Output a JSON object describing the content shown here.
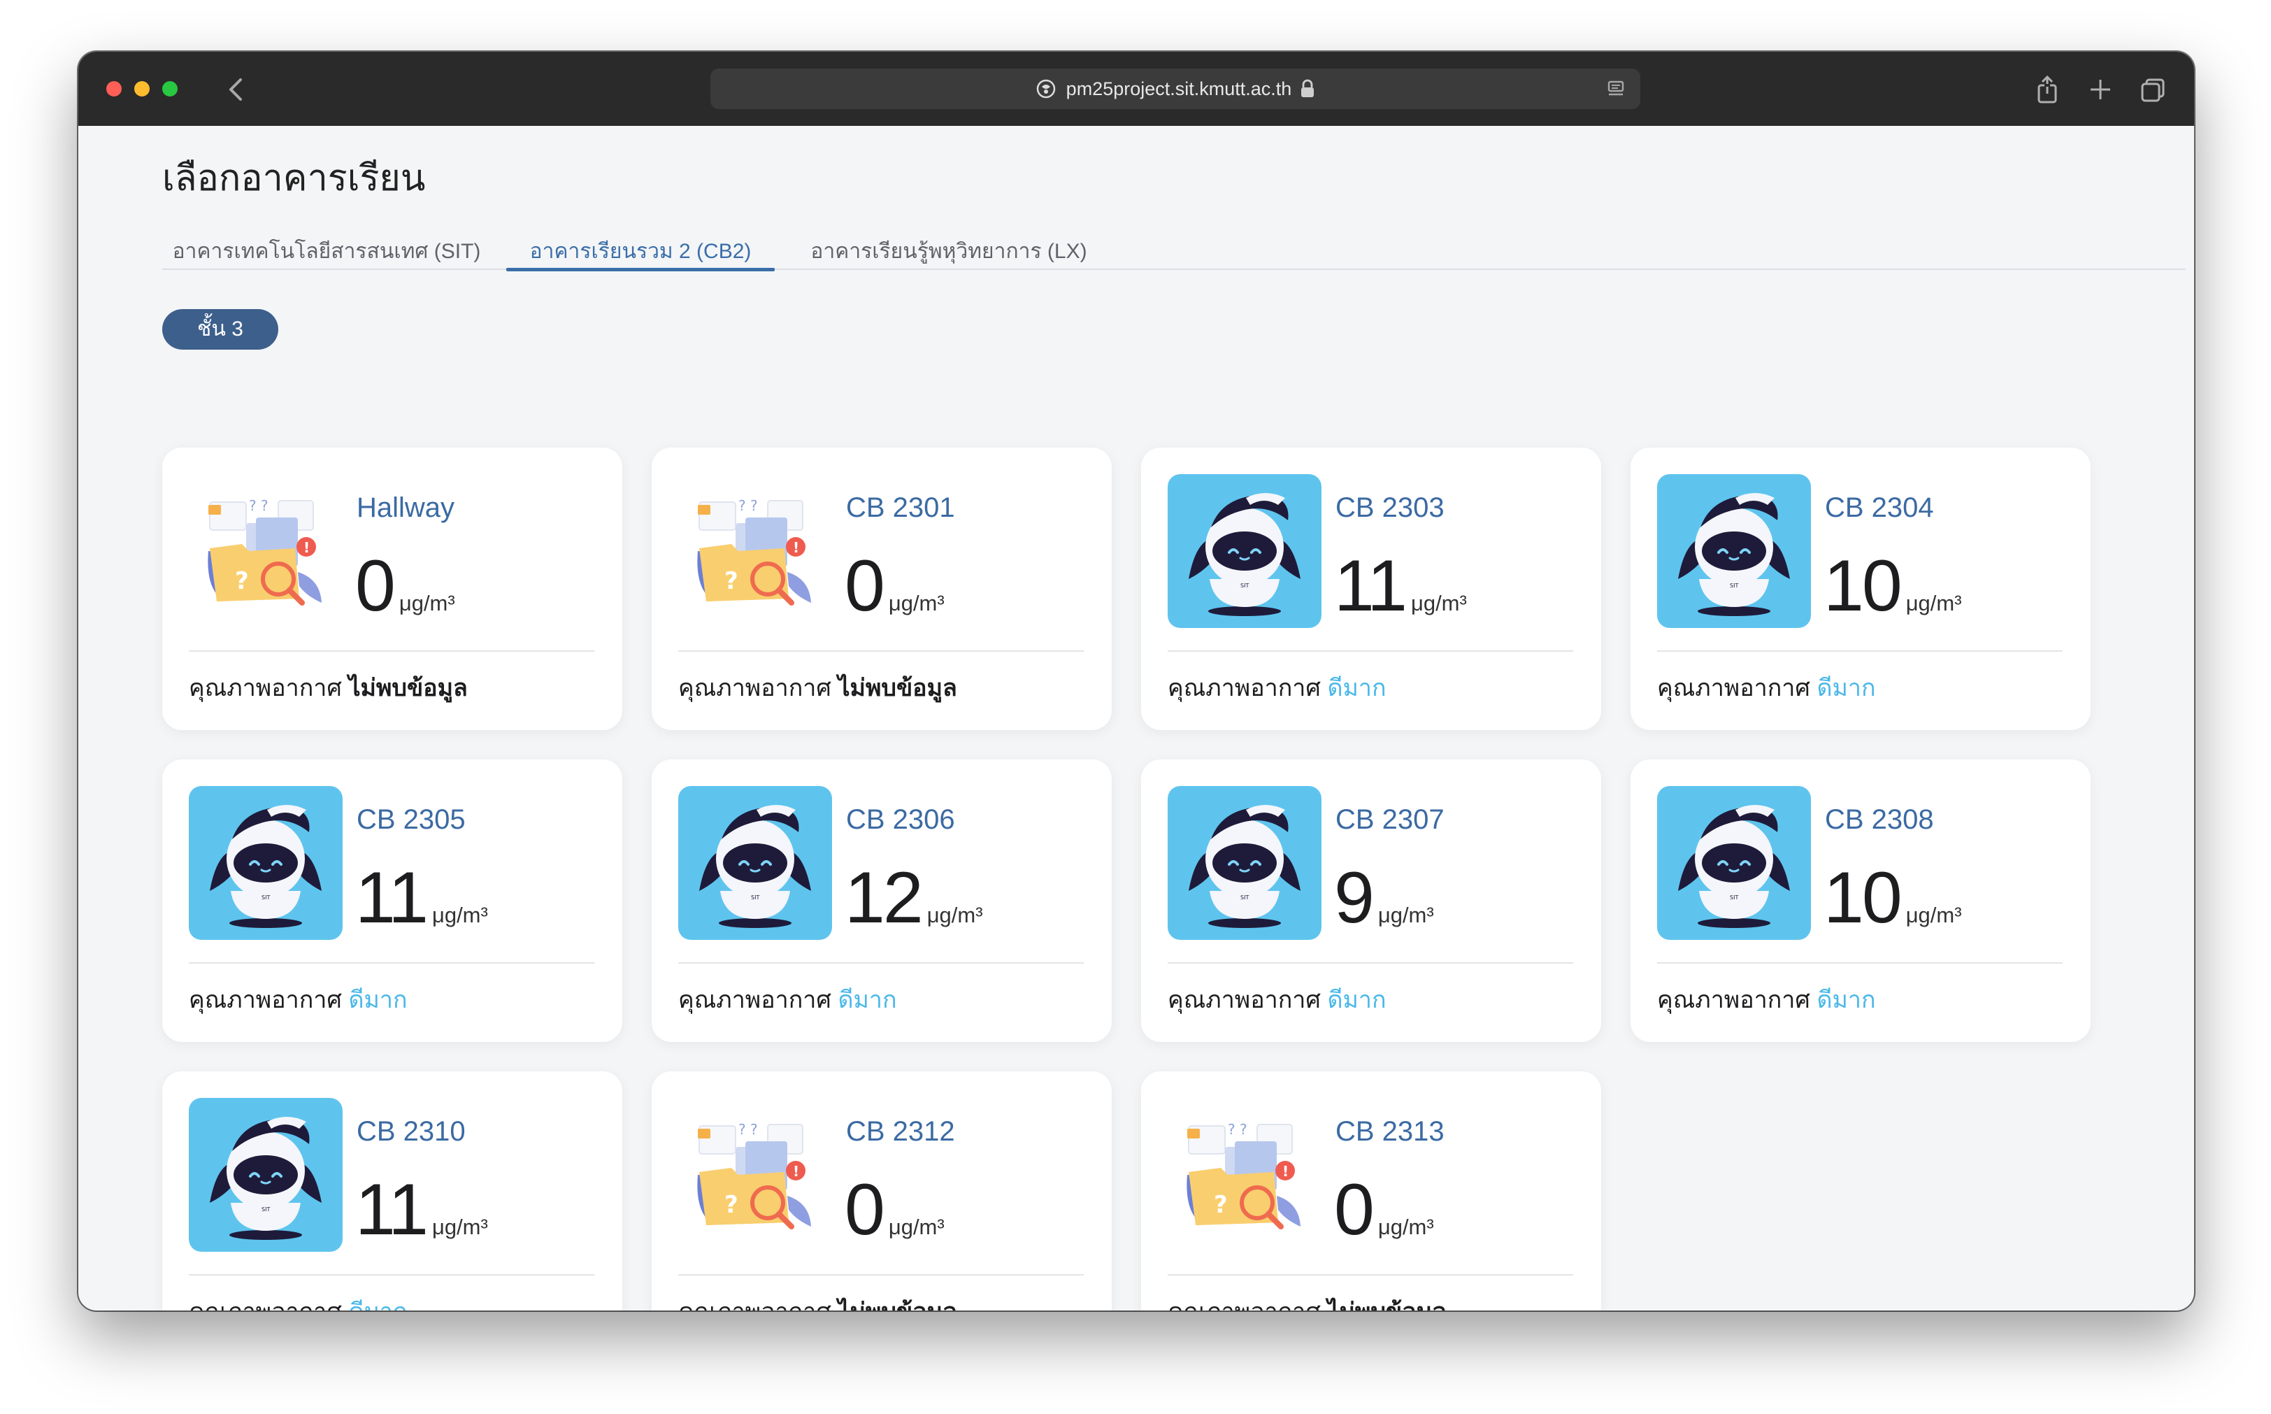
{
  "browser": {
    "url": "pm25project.sit.kmutt.ac.th"
  },
  "page": {
    "title": "เลือกอาคารเรียน",
    "tabs": [
      {
        "label": "อาคารเทคโนโลยีสารสนเทศ (SIT)"
      },
      {
        "label": "อาคารเรียนรวม 2 (CB2)"
      },
      {
        "label": "อาคารเรียนรู้พหุวิทยาการ (LX)"
      }
    ],
    "floor": "ชั้น 3",
    "quality_label": "คุณภาพอากาศ",
    "unit": "μg/m³",
    "colors": {
      "accent": "#3a6ea8",
      "good": "#4ab8e8",
      "pill": "#3d5f8c",
      "robot_bg": "#5ec4ee"
    },
    "rooms": [
      {
        "name": "Hallway",
        "value": "0",
        "status": "ไม่พบข้อมูล",
        "icon": "folder-not-found-icon"
      },
      {
        "name": "CB 2301",
        "value": "0",
        "status": "ไม่พบข้อมูล",
        "icon": "folder-not-found-icon"
      },
      {
        "name": "CB 2303",
        "value": "11",
        "status": "ดีมาก",
        "icon": "robot-mascot-icon"
      },
      {
        "name": "CB 2304",
        "value": "10",
        "status": "ดีมาก",
        "icon": "robot-mascot-icon"
      },
      {
        "name": "CB 2305",
        "value": "11",
        "status": "ดีมาก",
        "icon": "robot-mascot-icon"
      },
      {
        "name": "CB 2306",
        "value": "12",
        "status": "ดีมาก",
        "icon": "robot-mascot-icon"
      },
      {
        "name": "CB 2307",
        "value": "9",
        "status": "ดีมาก",
        "icon": "robot-mascot-icon"
      },
      {
        "name": "CB 2308",
        "value": "10",
        "status": "ดีมาก",
        "icon": "robot-mascot-icon"
      },
      {
        "name": "CB 2310",
        "value": "11",
        "status": "ดีมาก",
        "icon": "robot-mascot-icon"
      },
      {
        "name": "CB 2312",
        "value": "0",
        "status": "ไม่พบข้อมูล",
        "icon": "folder-not-found-icon"
      },
      {
        "name": "CB 2313",
        "value": "0",
        "status": "ไม่พบข้อมูล",
        "icon": "folder-not-found-icon"
      }
    ]
  }
}
